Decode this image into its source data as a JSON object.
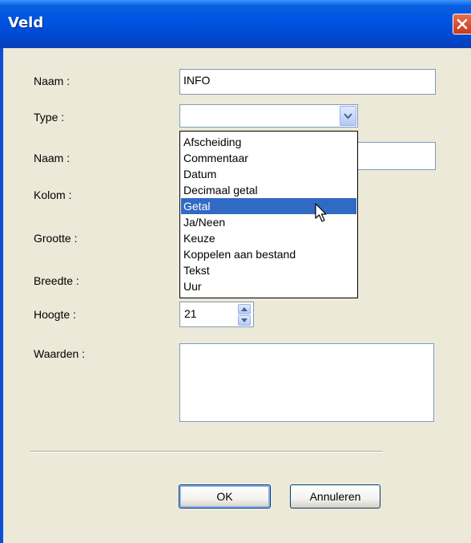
{
  "window": {
    "title": "Veld"
  },
  "form": {
    "naam1_label": "Naam :",
    "naam1_value": "INFO",
    "type_label": "Type :",
    "type_value": "",
    "naam2_label": "Naam :",
    "kolom_label": "Kolom :",
    "grootte_label": "Grootte :",
    "breedte_label": "Breedte :",
    "hoogte_label": "Hoogte :",
    "hoogte_value": "21",
    "waarden_label": "Waarden :"
  },
  "dropdown": {
    "items": [
      "Afscheiding",
      "Commentaar",
      "Datum",
      "Decimaal getal",
      "Getal",
      "Ja/Neen",
      "Keuze",
      "Koppelen aan bestand",
      "Tekst",
      "Uur"
    ],
    "highlighted": "Getal"
  },
  "buttons": {
    "ok": "OK",
    "cancel": "Annuleren"
  },
  "colors": {
    "titlebar": "#0054e3",
    "selection": "#316ac5",
    "dialog_bg": "#ece9d8"
  }
}
